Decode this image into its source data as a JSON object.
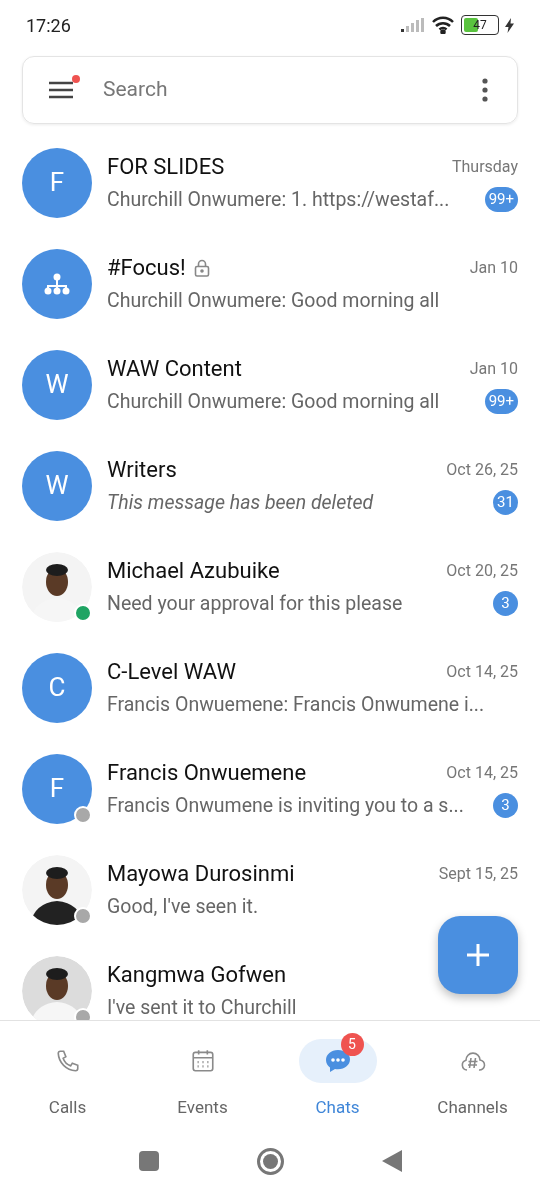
{
  "status_bar": {
    "time": "17:26",
    "battery": "47"
  },
  "search": {
    "placeholder": "Search",
    "menu_notification": true
  },
  "chats": [
    {
      "avatar": {
        "kind": "letter",
        "letter": "F"
      },
      "name": "FOR SLIDES",
      "locked": false,
      "time": "Thursday",
      "preview": "Churchill Onwumere: 1. https://westaf...",
      "italic": false,
      "unread": "99+"
    },
    {
      "avatar": {
        "kind": "group"
      },
      "name": "#Focus!",
      "locked": true,
      "time": "Jan 10",
      "preview": "Churchill Onwumere: Good morning all",
      "italic": false
    },
    {
      "avatar": {
        "kind": "letter",
        "letter": "W"
      },
      "name": "WAW Content",
      "locked": false,
      "time": "Jan 10",
      "preview": "Churchill Onwumere: Good morning all",
      "italic": false,
      "unread": "99+"
    },
    {
      "avatar": {
        "kind": "letter",
        "letter": "W"
      },
      "name": "Writers",
      "locked": false,
      "time": "Oct 26, 25",
      "preview": "This message has been deleted",
      "italic": true,
      "unread": "31"
    },
    {
      "presence": {
        "color": "#1fa463"
      },
      "name": "Michael Azubuike",
      "locked": false,
      "time": "Oct 20, 25",
      "preview": "Need your approval for this please",
      "italic": false,
      "unread": "3"
    },
    {
      "avatar": {
        "kind": "letter",
        "letter": "C"
      },
      "name": "C-Level WAW",
      "locked": false,
      "time": "Oct 14, 25",
      "preview": "Francis Onwuemene: Francis Onwumene i...",
      "italic": false
    },
    {
      "avatar": {
        "kind": "letter",
        "letter": "F"
      },
      "presence": {
        "color": "#a8a8a8"
      },
      "name": "Francis Onwuemene",
      "locked": false,
      "time": "Oct 14, 25",
      "preview": "Francis Onwumene is inviting you to a s...",
      "italic": false,
      "unread": "3"
    },
    {
      "presence": {
        "color": "#a8a8a8"
      },
      "name": "Mayowa Durosinmi",
      "locked": false,
      "time": "Sept 15, 25",
      "preview": "Good, I've seen it.",
      "italic": false
    },
    {
      "presence": {
        "color": "#a8a8a8"
      },
      "name": "Kangmwa Gofwen",
      "locked": false,
      "preview": "I've sent it to Churchill",
      "italic": false
    }
  ],
  "tabs": [
    {
      "kind": "calls",
      "label": "Calls",
      "selected": false
    },
    {
      "kind": "events",
      "label": "Events",
      "selected": false
    },
    {
      "kind": "chats",
      "label": "Chats",
      "selected": true,
      "badge": "5"
    },
    {
      "kind": "channels",
      "label": "Channels",
      "selected": false
    }
  ]
}
